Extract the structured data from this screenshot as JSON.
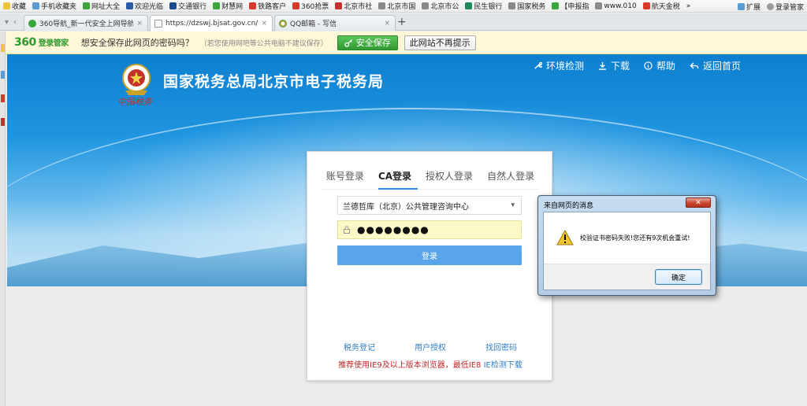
{
  "bookmarks": {
    "items": [
      {
        "label": "收藏",
        "color": "#f0c33c"
      },
      {
        "label": "手机收藏夹",
        "color": "#5b9bd5"
      },
      {
        "label": "网址大全",
        "color": "#3aa53a"
      },
      {
        "label": "欢迎光临",
        "color": "#2a5aa8"
      },
      {
        "label": "交通银行",
        "color": "#1b4b8f"
      },
      {
        "label": "财慧网",
        "color": "#3aa53a"
      },
      {
        "label": "铁路客户",
        "color": "#d9382a"
      },
      {
        "label": "360抢票",
        "color": "#d9382a"
      },
      {
        "label": "北京市社",
        "color": "#c9302c"
      },
      {
        "label": "北京市国",
        "color": "#8a8a8a"
      },
      {
        "label": "北京市公",
        "color": "#8a8a8a"
      },
      {
        "label": "民生银行",
        "color": "#1d8a5a"
      },
      {
        "label": "国家税务",
        "color": "#8a8a8a"
      },
      {
        "label": "【申报指",
        "color": "#3aa53a"
      },
      {
        "label": "www.010",
        "color": "#8a8a8a"
      },
      {
        "label": "航天金税",
        "color": "#d9382a"
      }
    ],
    "more": "»",
    "extend_label": "扩展",
    "login_label": "登录管家"
  },
  "tabs": {
    "items": [
      {
        "label": "360导航_新一代安全上网导航",
        "icon_color": "#3aa53a",
        "active": false
      },
      {
        "label": "https://dzswj.bjsat.gov.cn/ssc",
        "icon_color": "#ffffff",
        "active": true
      },
      {
        "label": "QQ邮箱 - 写信",
        "icon_color": "#e8a33c",
        "active": false
      }
    ],
    "close": "×",
    "new_tab": "+"
  },
  "password_bar": {
    "brand": "360",
    "brand_sub": "登录管家",
    "question": "想安全保存此网页的密码吗？",
    "note": "（若您使用网吧等公共电脑不建议保存）",
    "save_label": "安全保存",
    "never_label": "此网站不再提示"
  },
  "header": {
    "title": "国家税务总局北京市电子税务局",
    "signature": "中国税务",
    "nav": [
      {
        "label": "环境检测",
        "icon": "wrench-icon"
      },
      {
        "label": "下载",
        "icon": "download-icon"
      },
      {
        "label": "帮助",
        "icon": "info-icon"
      },
      {
        "label": "返回首页",
        "icon": "back-icon"
      }
    ]
  },
  "login": {
    "tabs": [
      "账号登录",
      "CA登录",
      "授权人登录",
      "自然人登录"
    ],
    "active_tab": "CA登录",
    "org_value": "兰德哲库（北京）公共管理咨询中心",
    "password_mask": "●●●●●●●●",
    "submit_label": "登录",
    "links": [
      "税务登记",
      "用户授权",
      "找回密码"
    ],
    "notice": "推荐使用IE9及以上版本浏览器，最低IE8",
    "notice_link": "IE检测下载"
  },
  "dialog": {
    "title": "来自网页的消息",
    "close": "✕",
    "message": "校验证书密码失败!您还有9次机会重试!",
    "ok_label": "确定"
  }
}
